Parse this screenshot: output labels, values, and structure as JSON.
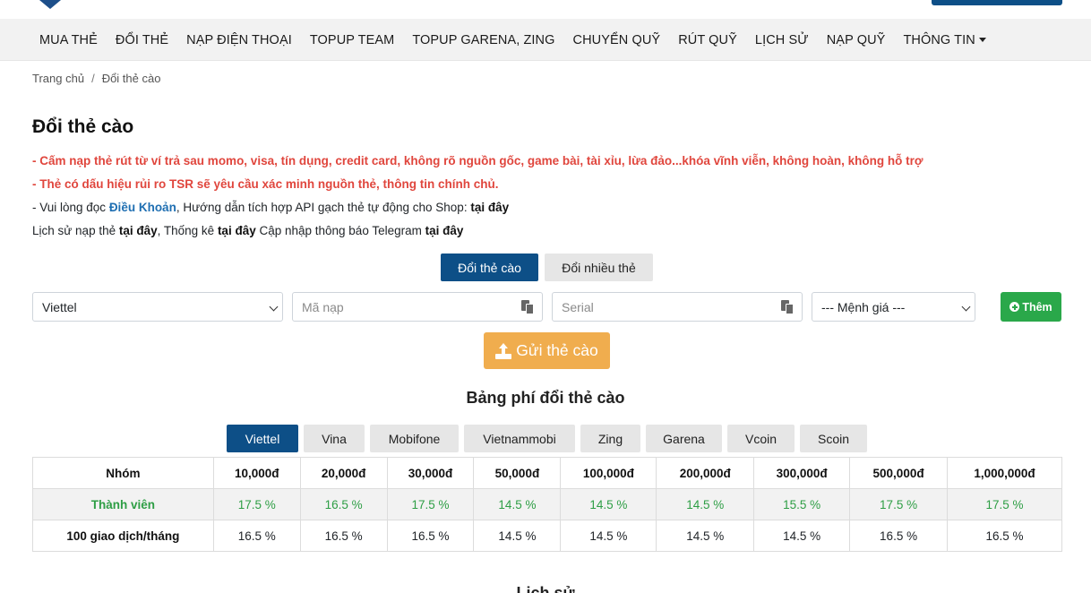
{
  "nav": {
    "items": [
      "MUA THẺ",
      "ĐỔI THẺ",
      "NẠP ĐIỆN THOẠI",
      "TOPUP TEAM",
      "TOPUP GARENA, ZING",
      "CHUYỂN QUỸ",
      "RÚT QUỸ",
      "LỊCH SỬ",
      "NẠP QUỸ",
      "THÔNG TIN"
    ]
  },
  "breadcrumb": {
    "home": "Trang chủ",
    "separator": "/",
    "current": "Đổi thẻ cào"
  },
  "page_title": "Đổi thẻ cào",
  "notes": {
    "warning1": "- Cấm nạp thẻ rút từ ví trả sau momo, visa, tín dụng, credit card, không rõ nguồn gốc, game bài, tài xỉu, lừa đảo...khóa vĩnh viễn, không hoàn, không hỗ trợ",
    "warning2": "- Thẻ có dấu hiệu rủi ro TSR sẽ yêu cầu xác minh nguồn thẻ, thông tin chính chủ.",
    "line3_prefix": "- Vui lòng đọc ",
    "line3_link": "Điều Khoản",
    "line3_mid": ", Hướng dẫn tích hợp API gạch thẻ tự động cho Shop: ",
    "line3_here": "tại đây",
    "line4_a": "Lịch sử nạp thẻ ",
    "line4_here1": "tại đây",
    "line4_b": ", Thống kê ",
    "line4_here2": "tại đây",
    "line4_c": " Cập nhập thông báo Telegram ",
    "line4_here3": "tại đây"
  },
  "mode_tabs": {
    "single": "Đổi thẻ cào",
    "multi": "Đổi nhiều thẻ"
  },
  "form": {
    "telco_value": "Viettel",
    "code_placeholder": "Mã nạp",
    "serial_placeholder": "Serial",
    "amount_value": "--- Mệnh giá ---",
    "add_label": "Thêm",
    "submit_label": "Gửi thẻ cào"
  },
  "fee_title": "Bảng phí đổi thẻ cào",
  "provider_tabs": [
    "Viettel",
    "Vina",
    "Mobifone",
    "Vietnammobi",
    "Zing",
    "Garena",
    "Vcoin",
    "Scoin"
  ],
  "fee_table": {
    "headers": [
      "Nhóm",
      "10,000đ",
      "20,000đ",
      "30,000đ",
      "50,000đ",
      "100,000đ",
      "200,000đ",
      "300,000đ",
      "500,000đ",
      "1,000,000đ"
    ],
    "rows": [
      [
        "Thành viên",
        "17.5 %",
        "16.5 %",
        "17.5 %",
        "14.5 %",
        "14.5 %",
        "14.5 %",
        "15.5 %",
        "17.5 %",
        "17.5 %"
      ],
      [
        "100 giao dịch/tháng",
        "16.5 %",
        "16.5 %",
        "16.5 %",
        "14.5 %",
        "14.5 %",
        "14.5 %",
        "14.5 %",
        "16.5 %",
        "16.5 %"
      ]
    ]
  },
  "history_title": "Lịch sử",
  "colors": {
    "primary": "#0d4f87",
    "success": "#2aa84a",
    "warning": "#f0ad4e",
    "danger": "#e0463d"
  }
}
